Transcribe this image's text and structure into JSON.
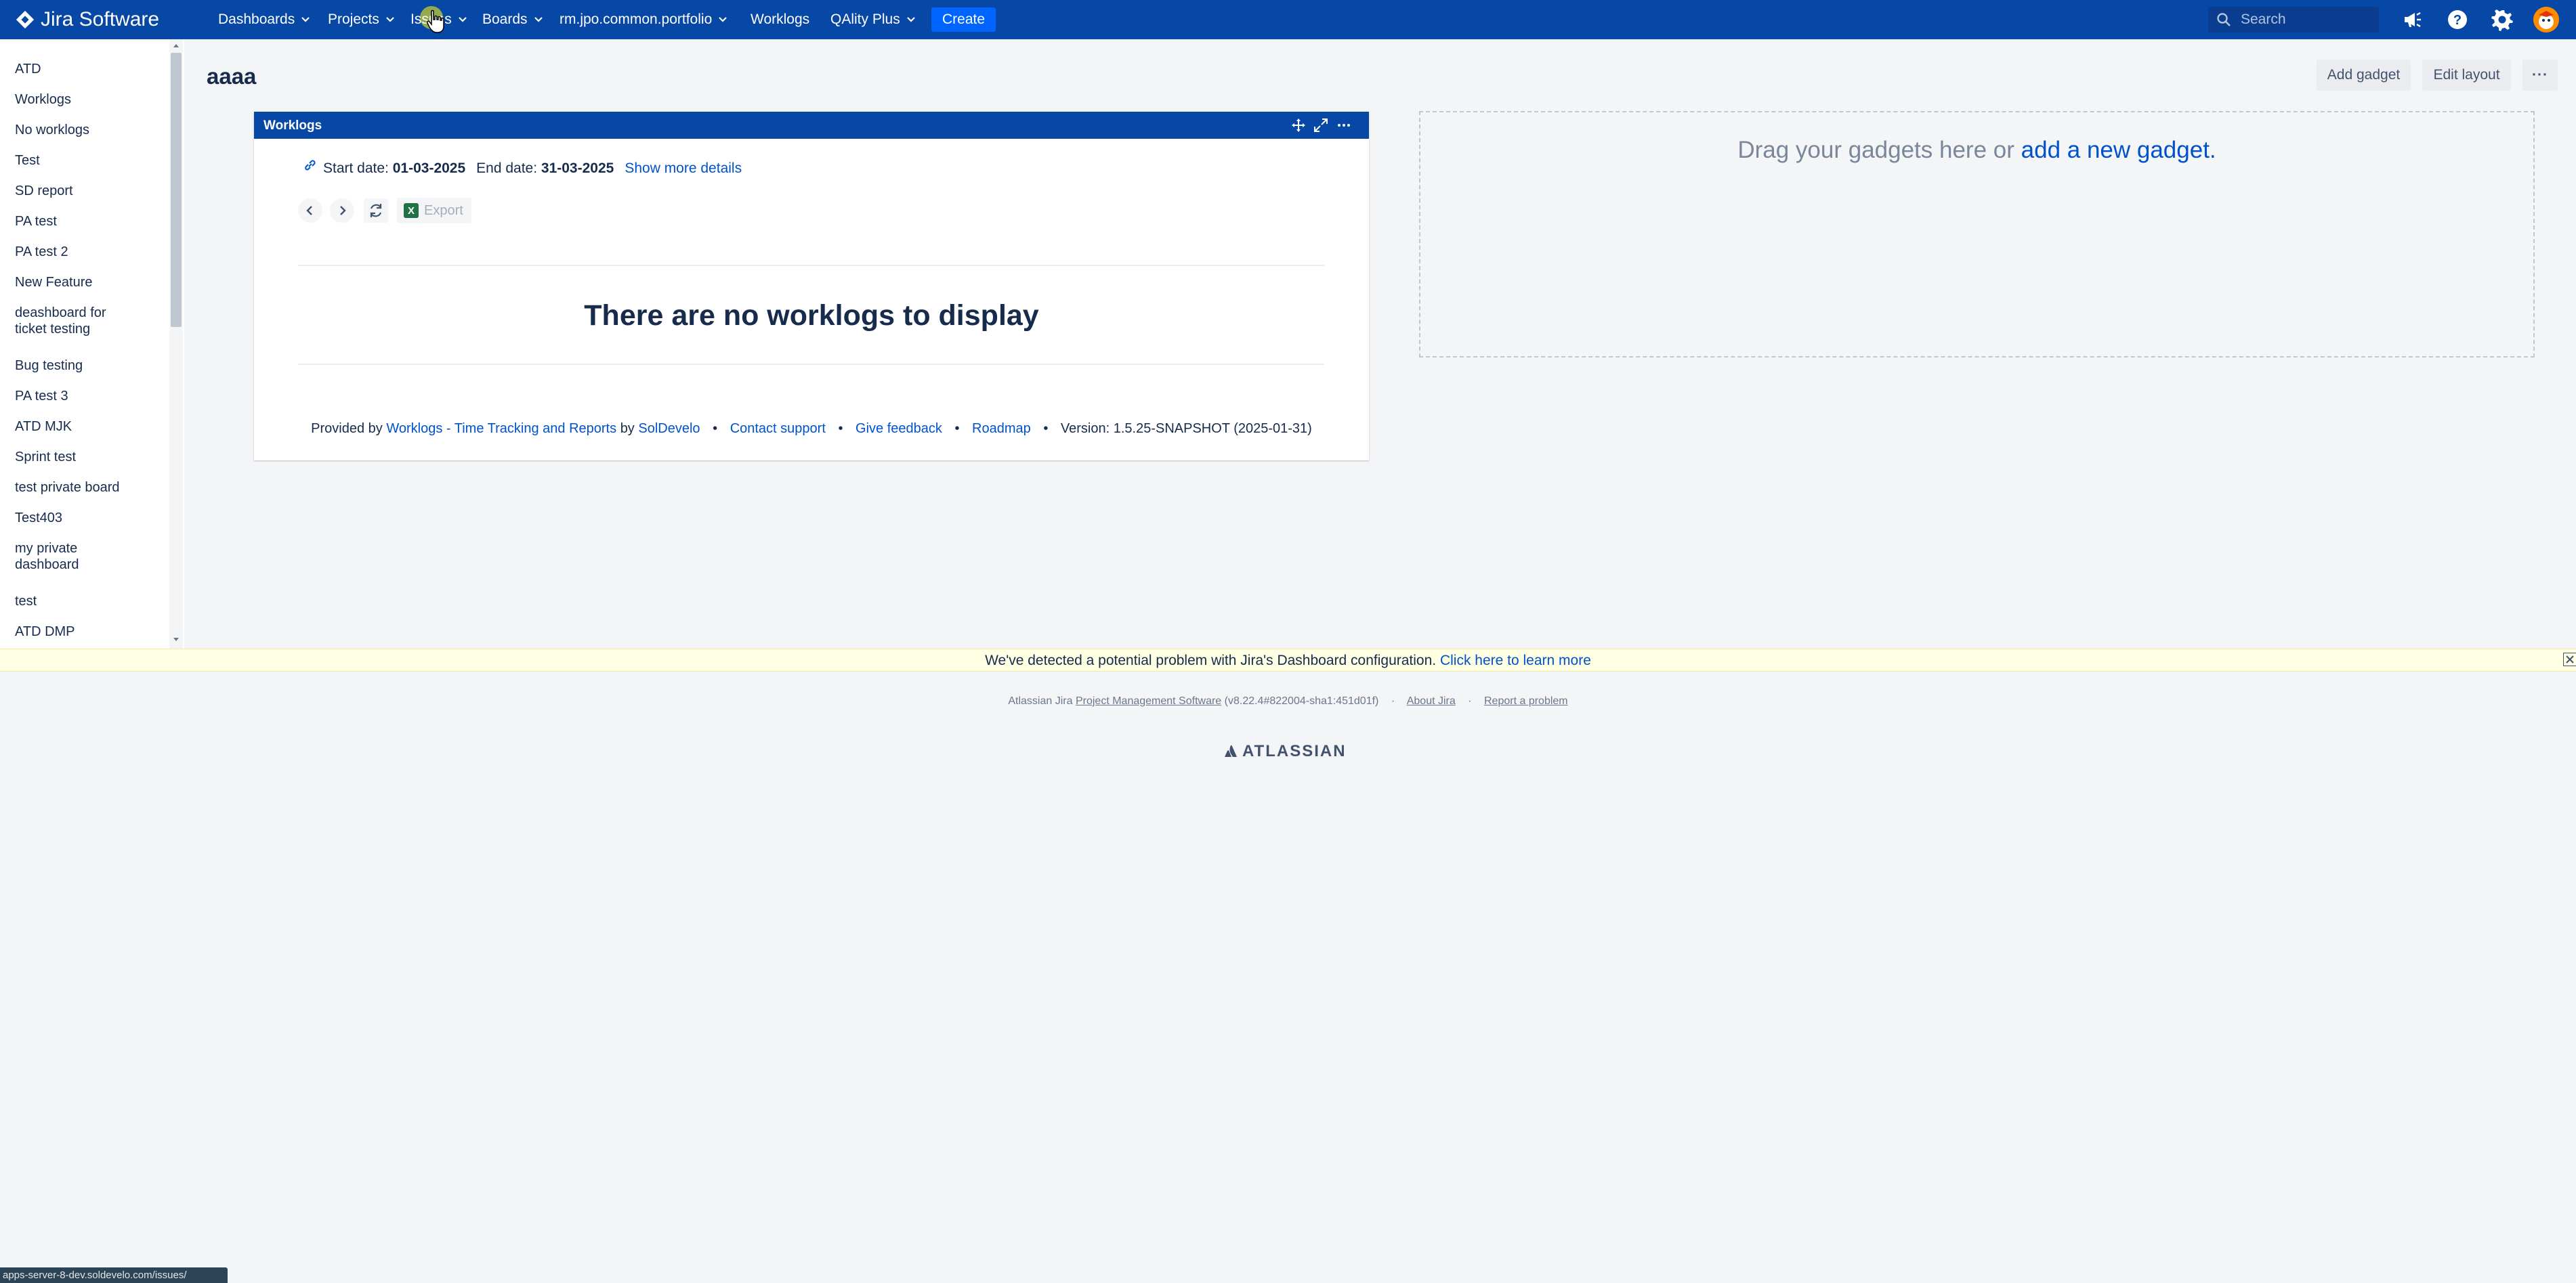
{
  "topnav": {
    "product_name": "Jira Software",
    "menu": [
      {
        "label": "Dashboards"
      },
      {
        "label": "Projects"
      },
      {
        "label": "Issues"
      },
      {
        "label": "Boards"
      },
      {
        "label": "rm.jpo.common.portfolio"
      },
      {
        "label": "Worklogs"
      },
      {
        "label": "QAlity Plus"
      }
    ],
    "create_label": "Create",
    "search_placeholder": "Search",
    "icons": [
      "megaphone-icon",
      "help-icon",
      "gear-icon",
      "avatar"
    ]
  },
  "sidebar": {
    "items": [
      {
        "label": "ATD"
      },
      {
        "label": "Worklogs"
      },
      {
        "label": "No worklogs"
      },
      {
        "label": "Test"
      },
      {
        "label": "SD report"
      },
      {
        "label": "PA test"
      },
      {
        "label": "PA test 2"
      },
      {
        "label": "New Feature"
      },
      {
        "label": "deashboard for ticket testing"
      },
      {
        "label": "Bug testing"
      },
      {
        "label": "PA test 3"
      },
      {
        "label": "ATD MJK"
      },
      {
        "label": "Sprint test"
      },
      {
        "label": "test private board"
      },
      {
        "label": "Test403"
      },
      {
        "label": "my private dashboard"
      },
      {
        "label": "test"
      },
      {
        "label": "ATD DMP"
      }
    ]
  },
  "main": {
    "title": "aaaa",
    "add_gadget_label": "Add gadget",
    "edit_layout_label": "Edit layout",
    "more_label": "···"
  },
  "gadget": {
    "title": "Worklogs",
    "start_label": "Start date:",
    "start_value": "01-03-2025",
    "end_label": "End date:",
    "end_value": "31-03-2025",
    "show_more": "Show more details",
    "export_label": "Export",
    "empty_message": "There are no worklogs to display",
    "footer": {
      "provided_by": "Provided by",
      "app_link": "Worklogs - Time Tracking and Reports",
      "by": "by",
      "vendor": "SolDevelo",
      "contact": "Contact support",
      "feedback": "Give feedback",
      "roadmap": "Roadmap",
      "version": "Version: 1.5.25-SNAPSHOT (2025-01-31)",
      "bullet": "•"
    }
  },
  "dropzone": {
    "text": "Drag your gadgets here or",
    "link": "add a new gadget."
  },
  "banner": {
    "text": "We've detected a potential problem with Jira's Dashboard configuration.",
    "link": "Click here to learn more"
  },
  "page_footer": {
    "prefix": "Atlassian Jira",
    "pm_link": "Project Management Software",
    "version": "(v8.22.4#822004-sha1:451d01f)",
    "about": "About Jira",
    "report": "Report a problem",
    "dot": "·",
    "brand": "ATLASSIAN"
  },
  "statusbar": {
    "url": "apps-server-8-dev.soldevelo.com/issues/"
  },
  "colors": {
    "nav_bg": "#0747a6",
    "create_bg": "#0065ff",
    "link": "#0052cc",
    "banner_bg": "#ffffe3",
    "page_bg": "#f4f5f7"
  }
}
